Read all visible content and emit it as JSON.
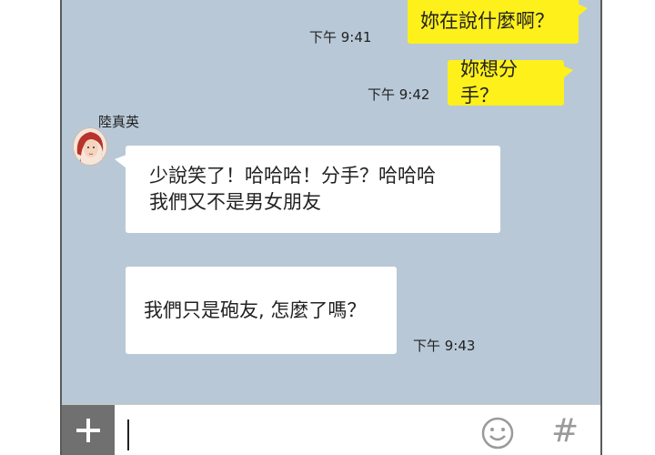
{
  "chat": {
    "messages": [
      {
        "direction": "outgoing",
        "text": "妳在說什麼啊？",
        "time": "下午 9:41"
      },
      {
        "direction": "outgoing",
        "text": "妳想分手？",
        "time": "下午 9:42"
      },
      {
        "direction": "incoming",
        "sender": "陸真英",
        "lines": [
          "少說笑了！哈哈哈！分手？哈哈哈",
          "我們又不是男女朋友"
        ]
      },
      {
        "direction": "incoming",
        "text": "我們只是砲友, 怎麼了嗎？",
        "time": "下午 9:43"
      }
    ]
  },
  "input_bar": {
    "plus_icon": "plus-icon",
    "emoji_icon": "smiley-icon",
    "hash_label": "#"
  },
  "colors": {
    "chat_background": "#b8c8d7",
    "outgoing_bubble": "#fef01b",
    "incoming_bubble": "#ffffff",
    "plus_button": "#707070"
  }
}
